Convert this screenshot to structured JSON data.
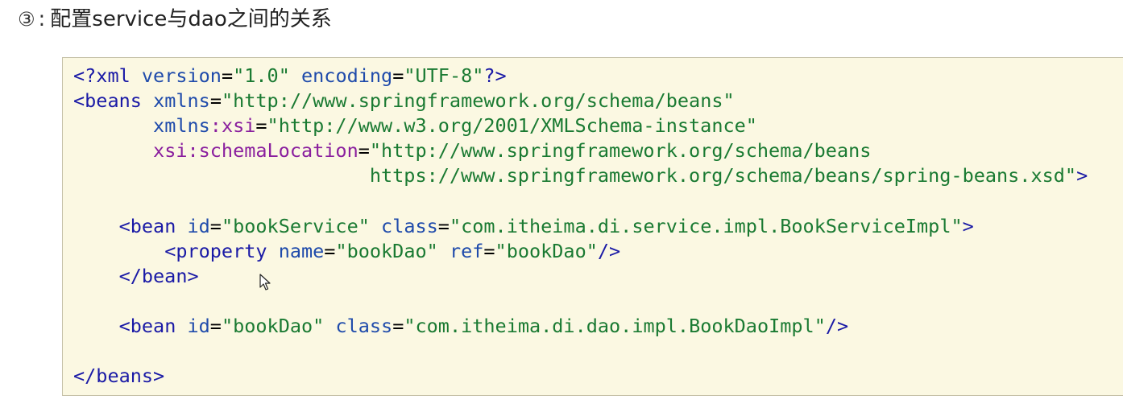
{
  "heading": {
    "number": "③",
    "colon": ":",
    "text": "配置service与dao之间的关系"
  },
  "code": {
    "xml_decl": {
      "open": "<?",
      "tag": "xml",
      "attr1": "version",
      "val1": "\"1.0\"",
      "attr2": "encoding",
      "val2": "\"UTF-8\"",
      "close": "?>"
    },
    "beans_open": {
      "lt": "<",
      "tag": "beans",
      "attr": "xmlns",
      "val": "\"http://www.springframework.org/schema/beans\""
    },
    "xmlns_xsi": {
      "prefix": "xmlns",
      "ns": ":xsi",
      "val": "\"http://www.w3.org/2001/XMLSchema-instance\""
    },
    "schema_location": {
      "ns": "xsi:schemaLocation",
      "val": "\"http://www.springframework.org/schema/beans"
    },
    "schema_location_cont": {
      "val": "https://www.springframework.org/schema/beans/spring-beans.xsd\"",
      "close": ">"
    },
    "bean_service": {
      "lt": "<",
      "tag": "bean",
      "attr1": "id",
      "val1": "\"bookService\"",
      "attr2": "class",
      "val2": "\"com.itheima.di.service.impl.BookServiceImpl\"",
      "close": ">"
    },
    "property": {
      "lt": "<",
      "tag": "property",
      "attr1": "name",
      "val1": "\"bookDao\"",
      "attr2": "ref",
      "val2": "\"bookDao\"",
      "close": "/>"
    },
    "bean_close": {
      "lt": "</",
      "tag": "bean",
      "close": ">"
    },
    "bean_dao": {
      "lt": "<",
      "tag": "bean",
      "attr1": "id",
      "val1": "\"bookDao\"",
      "attr2": "class",
      "val2": "\"com.itheima.di.dao.impl.BookDaoImpl\"",
      "close": "/>"
    },
    "beans_close": {
      "lt": "</",
      "tag": "beans",
      "close": ">"
    }
  },
  "colors": {
    "background": "#fbf8e2",
    "tag": "#1a1aa6",
    "attribute": "#1f4bab",
    "namespace": "#8a1f9e",
    "value": "#1a7a32"
  },
  "icons": {
    "cursor": "mouse-pointer-icon"
  }
}
